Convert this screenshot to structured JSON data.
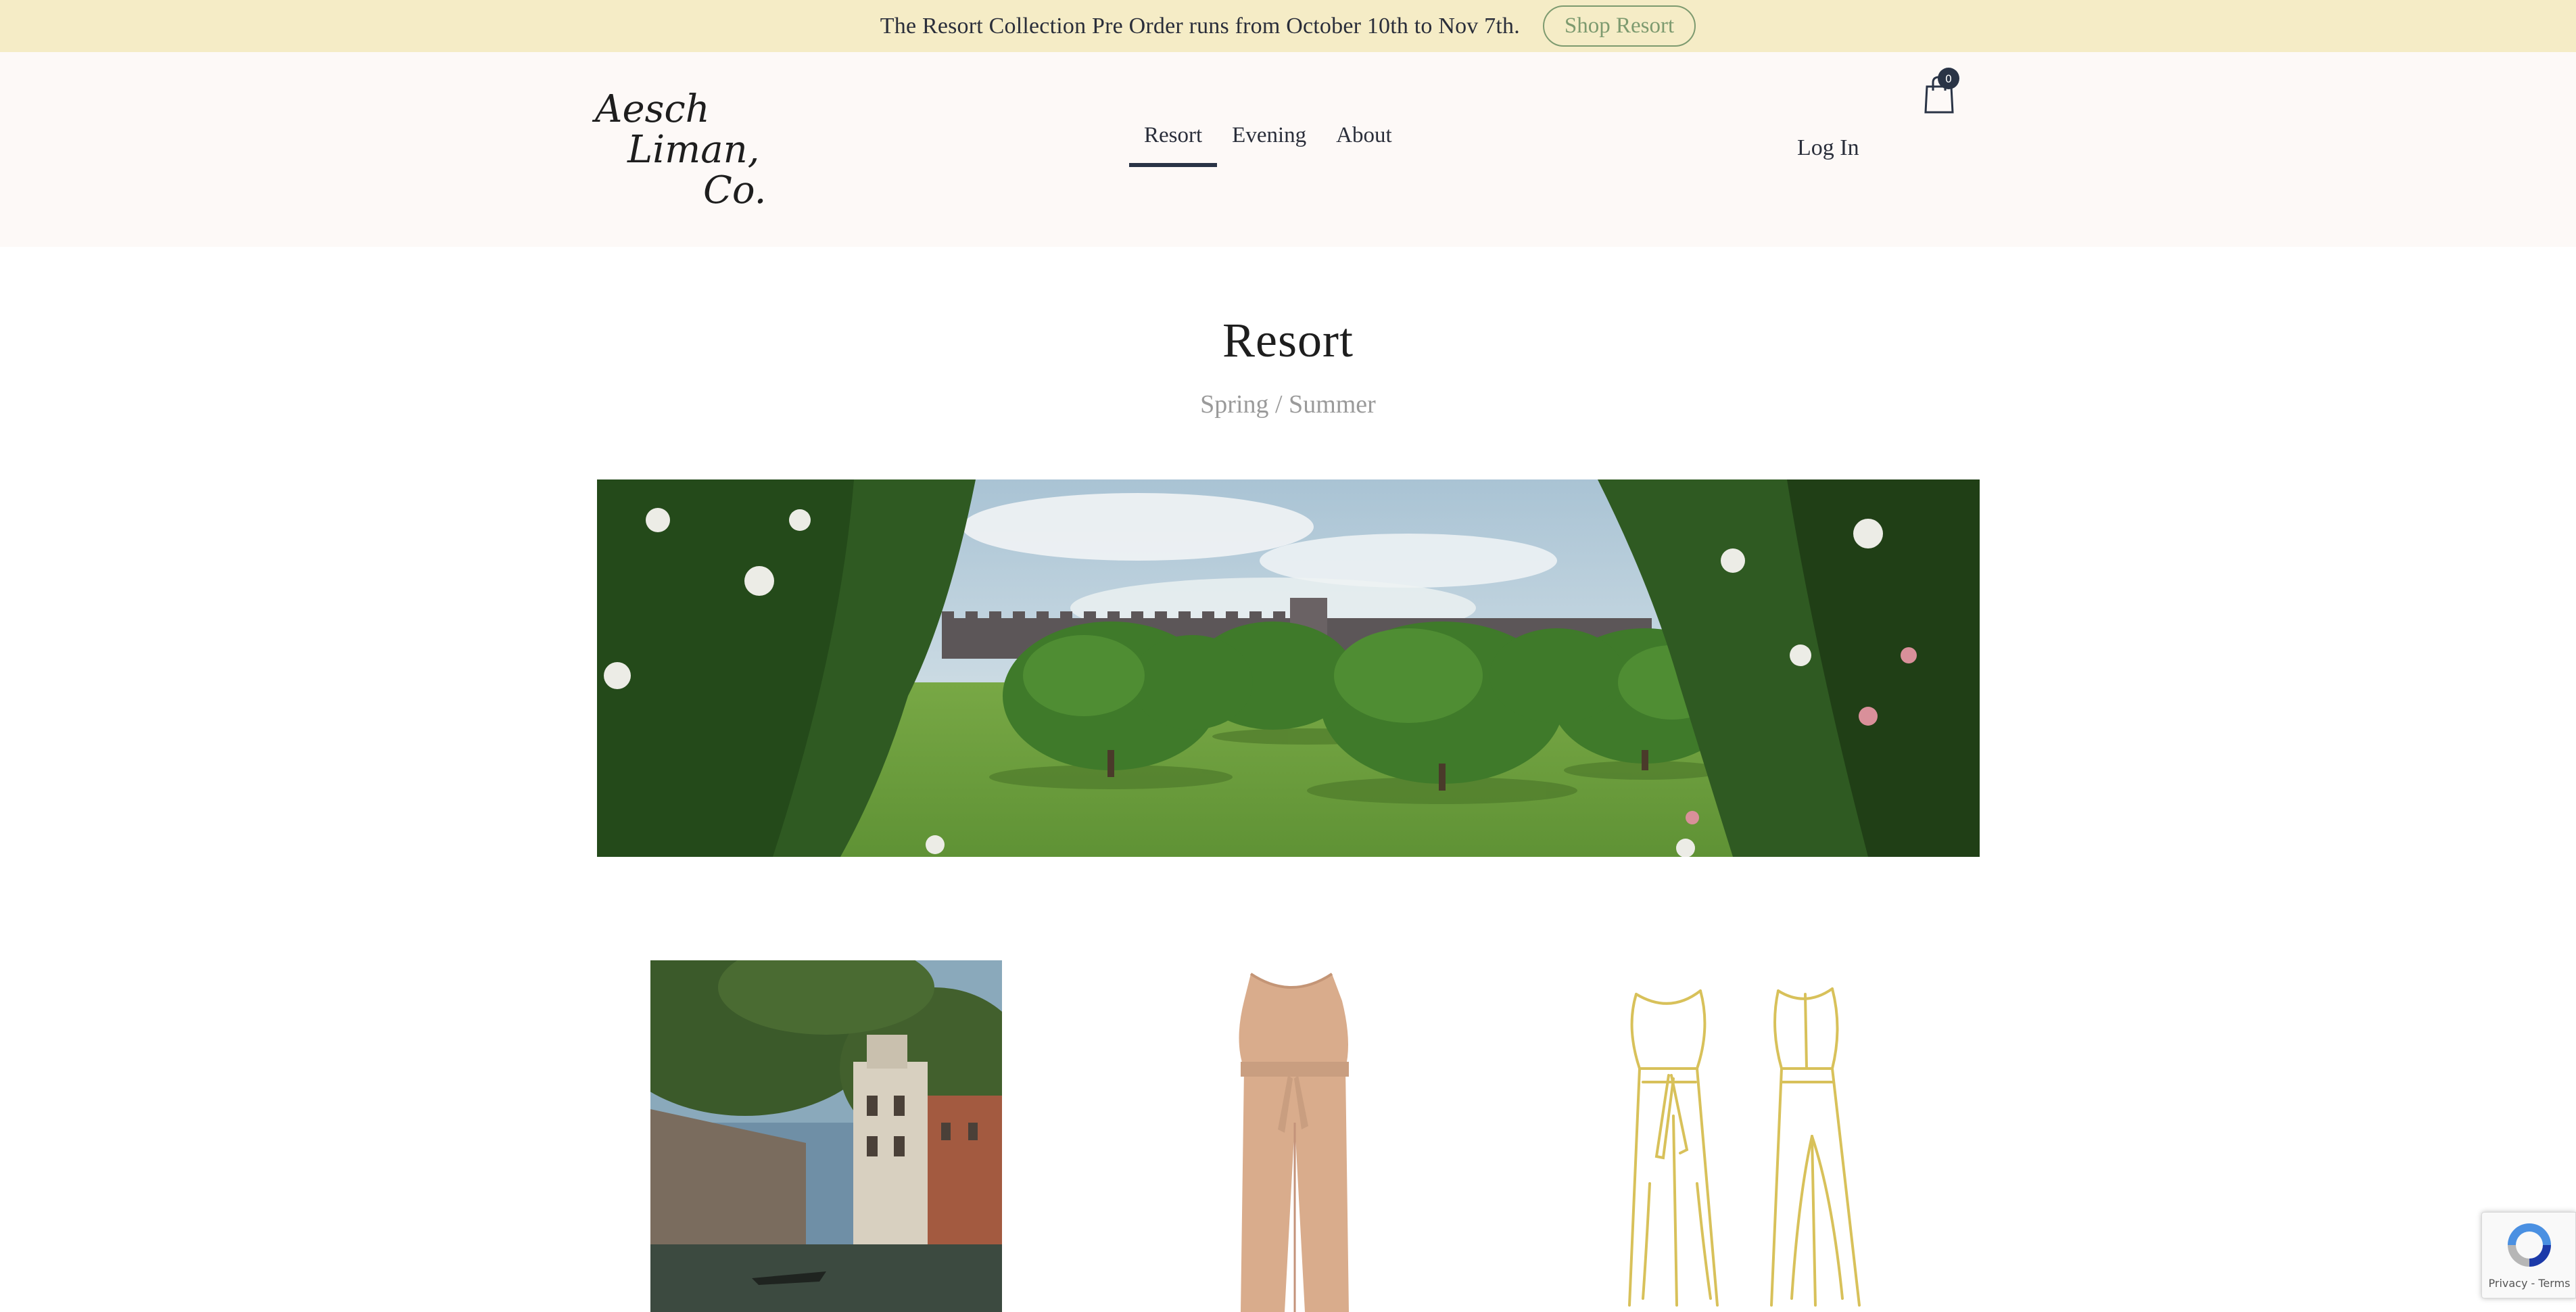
{
  "announcement": {
    "text": "The Resort Collection Pre Order runs from October 10th to Nov 7th.",
    "button_label": "Shop Resort"
  },
  "header": {
    "logo_lines": [
      "Aesch",
      "Liman,",
      "Co."
    ],
    "nav": [
      {
        "label": "Resort",
        "active": true
      },
      {
        "label": "Evening",
        "active": false
      },
      {
        "label": "About",
        "active": false
      }
    ],
    "login_label": "Log In",
    "cart_count": "0",
    "cart_icon": "shopping-bag-icon"
  },
  "main": {
    "title": "Resort",
    "subtitle": "Spring / Summer"
  },
  "products": [
    {
      "image": "venice-canal-painting"
    },
    {
      "image": "beige-jumpsuit-photo"
    },
    {
      "image": "jumpsuit-line-sketch"
    }
  ],
  "recaptcha": {
    "label": "Privacy - Terms"
  },
  "colors": {
    "announcement_bg": "#f5ecc6",
    "header_bg": "#fdf9f7",
    "accent_green": "#7d9a6f",
    "nav_underline": "#2a3446",
    "sketch_gold": "#d8c15a"
  }
}
